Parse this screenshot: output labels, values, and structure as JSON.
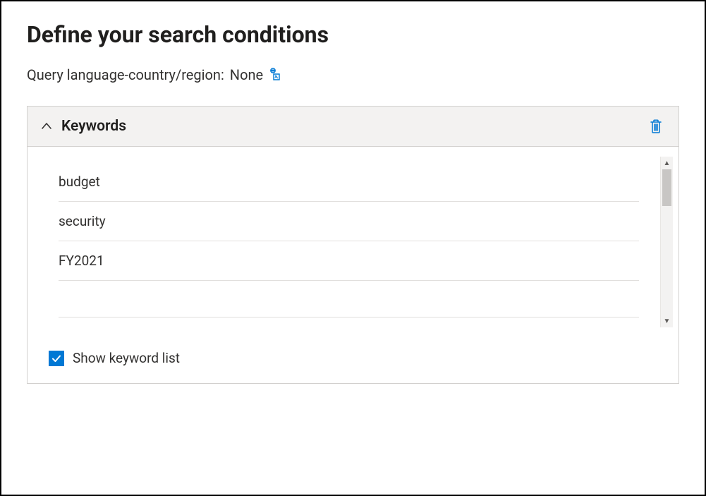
{
  "page": {
    "title": "Define your search conditions"
  },
  "queryLang": {
    "label": "Query language-country/region:",
    "value": "None"
  },
  "keywordsPanel": {
    "title": "Keywords",
    "items": [
      "budget",
      "security",
      "FY2021",
      ""
    ],
    "showListCheckbox": {
      "label": "Show keyword list",
      "checked": true
    }
  }
}
